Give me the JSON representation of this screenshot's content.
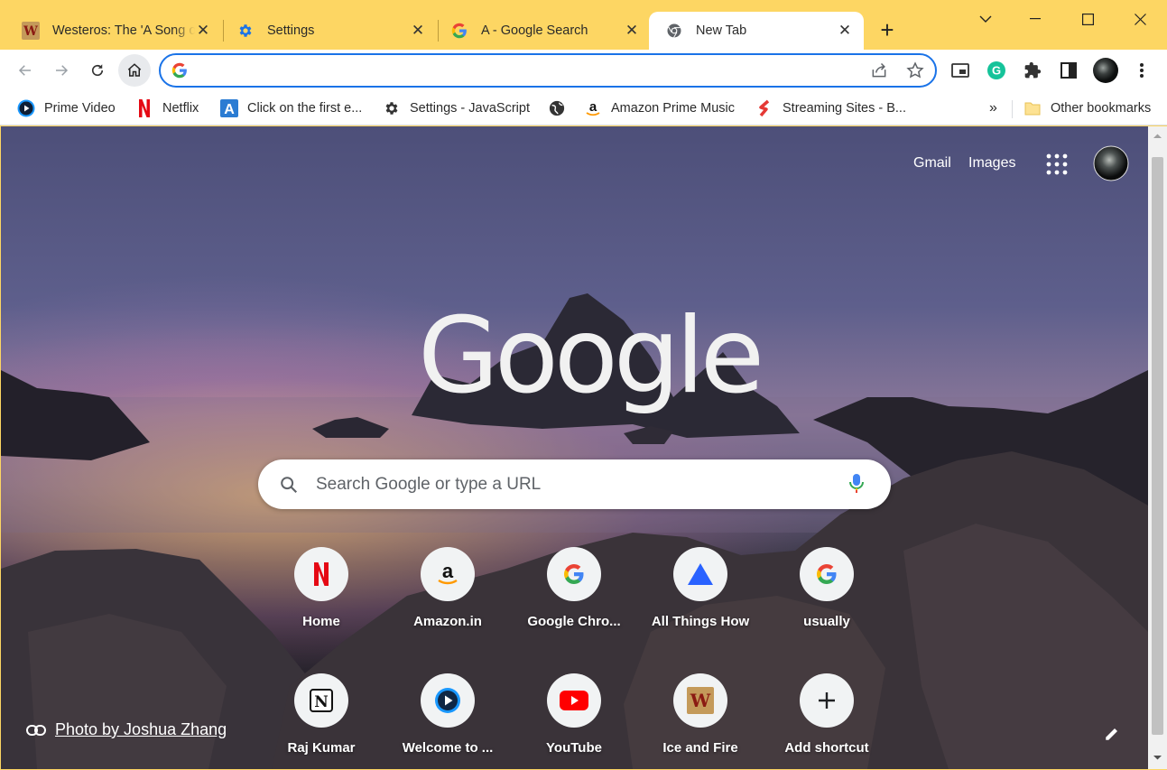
{
  "tabs": [
    {
      "title": "Westeros: The 'A Song of Ice and Fire'",
      "favicon": "westeros-icon"
    },
    {
      "title": "Settings",
      "favicon": "gear-icon"
    },
    {
      "title": "A - Google Search",
      "favicon": "google-g-icon"
    },
    {
      "title": "New Tab",
      "favicon": "chrome-icon",
      "active": true
    }
  ],
  "omnibox": {
    "value": "",
    "placeholder": ""
  },
  "bookmarks": [
    {
      "label": "Prime Video",
      "icon": "prime-video-icon"
    },
    {
      "label": "Netflix",
      "icon": "netflix-icon"
    },
    {
      "label": "Click on the first e...",
      "icon": "a-icon"
    },
    {
      "label": "Settings - JavaScript",
      "icon": "gear-icon"
    },
    {
      "label": "",
      "icon": "globe-icon"
    },
    {
      "label": "Amazon Prime Music",
      "icon": "amazon-icon"
    },
    {
      "label": "Streaming Sites - B...",
      "icon": "streaming-icon"
    }
  ],
  "bookmarks_more": "»",
  "other_bookmarks": "Other bookmarks",
  "ntp": {
    "gmail": "Gmail",
    "images": "Images",
    "logo": "Google",
    "search_placeholder": "Search Google or type a URL",
    "shortcuts": [
      {
        "label": "Home",
        "icon": "netflix-icon"
      },
      {
        "label": "Amazon.in",
        "icon": "amazon-icon"
      },
      {
        "label": "Google Chro...",
        "icon": "google-g-icon"
      },
      {
        "label": "All Things How",
        "icon": "triangle-icon"
      },
      {
        "label": "usually",
        "icon": "google-g-icon"
      },
      {
        "label": "Raj Kumar",
        "icon": "notion-icon"
      },
      {
        "label": "Welcome to ...",
        "icon": "prime-video-icon"
      },
      {
        "label": "YouTube",
        "icon": "youtube-icon"
      },
      {
        "label": "Ice and Fire",
        "icon": "westeros-icon"
      },
      {
        "label": "Add shortcut",
        "icon": "plus-icon"
      }
    ],
    "attribution": "Photo by Joshua Zhang"
  },
  "colors": {
    "tabstrip": "#fdd663",
    "accent": "#1a73e8"
  }
}
